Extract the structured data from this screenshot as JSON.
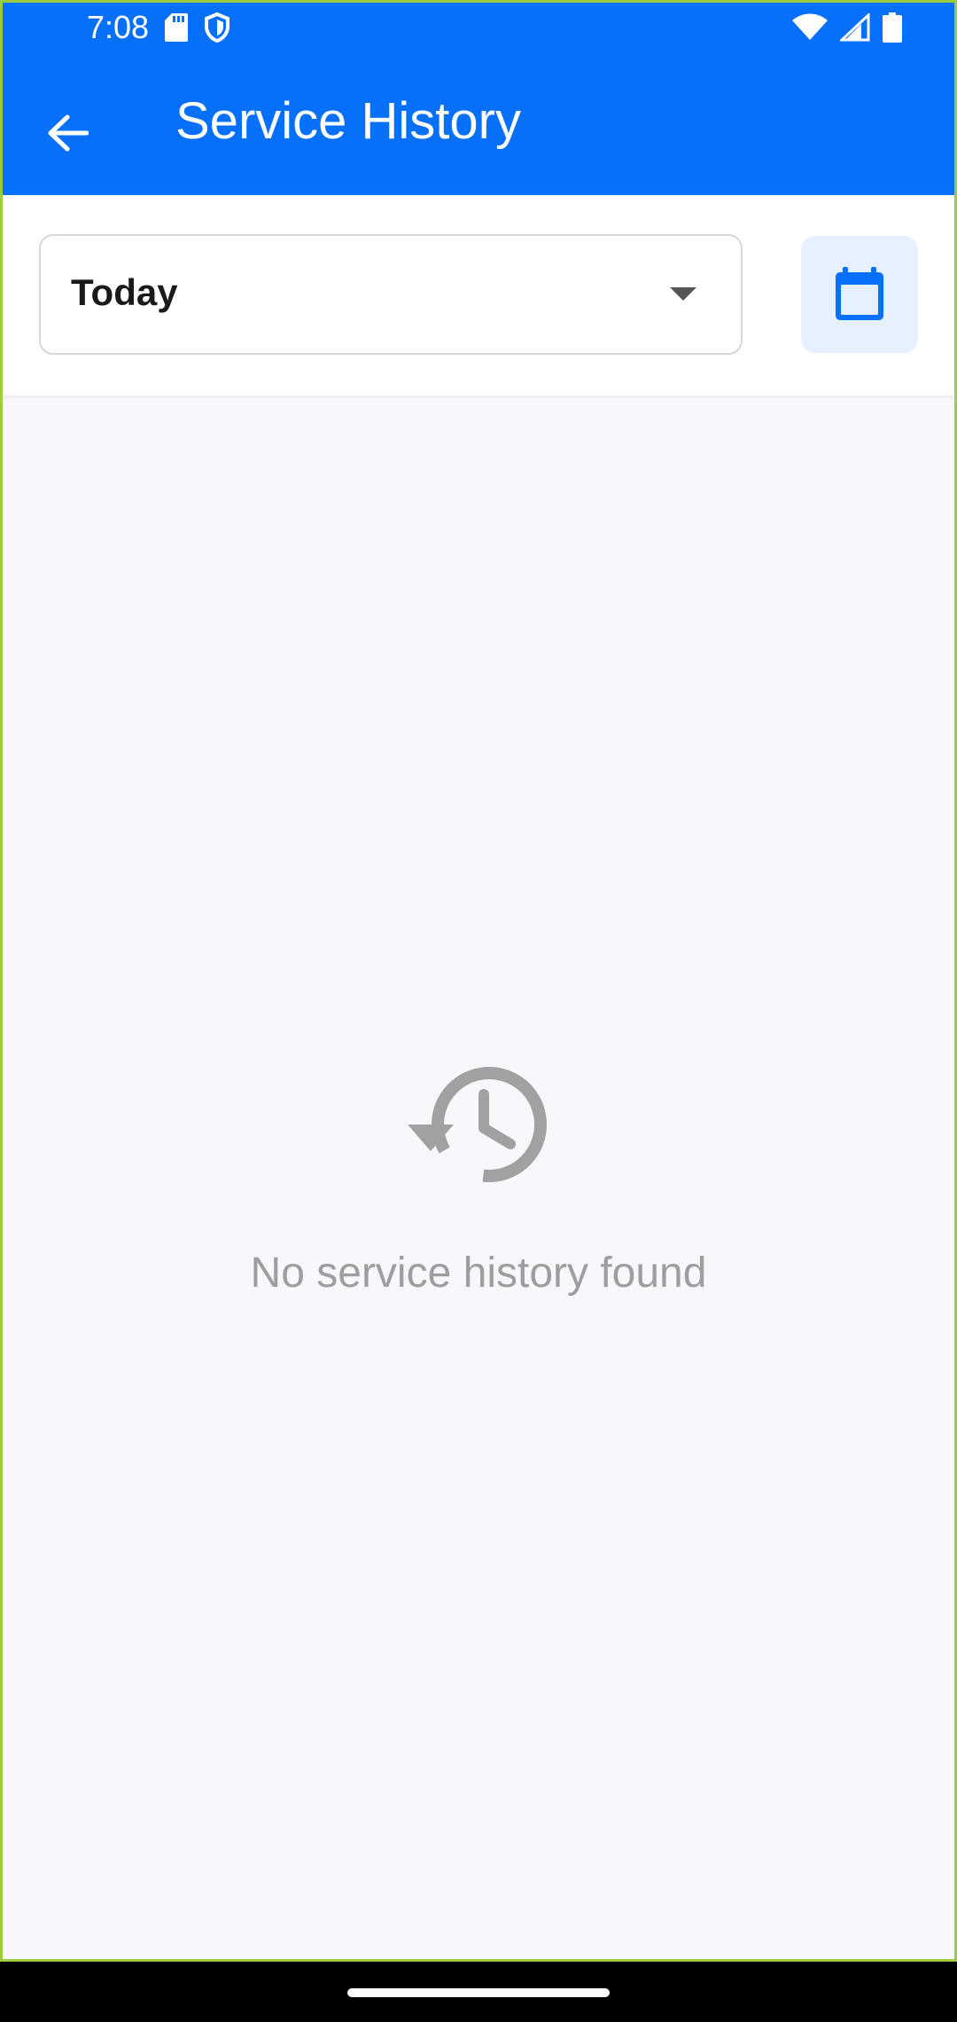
{
  "status_bar": {
    "time": "7:08",
    "left_icons": [
      "sd-card-icon",
      "shield-icon"
    ],
    "right_icons": [
      "wifi-icon",
      "signal-icon",
      "battery-icon"
    ]
  },
  "app_bar": {
    "title": "Service History",
    "back_icon": "arrow-back-icon",
    "color": "#0670fa"
  },
  "filter": {
    "selected": "Today",
    "calendar_icon": "calendar-icon"
  },
  "empty_state": {
    "icon": "history-icon",
    "message": "No service history found"
  },
  "colors": {
    "primary": "#0670fa",
    "background": "#f7f7fc",
    "muted_text": "#9e9e9e",
    "calendar_bg": "#e6f0fe"
  }
}
